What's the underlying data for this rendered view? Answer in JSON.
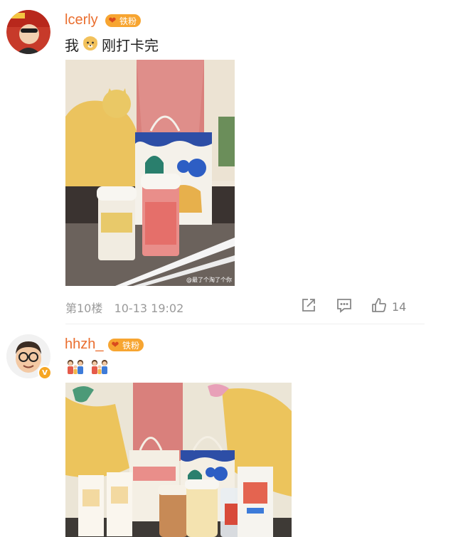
{
  "comments": [
    {
      "username": "lcerly",
      "badge": "铁粉",
      "text_before": "我",
      "emoji": "doge-emoji",
      "text_after": "刚打卡完",
      "photo_watermark": "@最了个淘了个你",
      "floor": "第10楼",
      "timestamp": "10-13 19:02",
      "like_count": "14"
    },
    {
      "username": "hhzh_",
      "badge": "铁粉",
      "text_emoji": "family-emoji"
    }
  ],
  "colors": {
    "username": "#ea6e2f",
    "badge": "#f7a531",
    "verified": "#f6a623"
  }
}
